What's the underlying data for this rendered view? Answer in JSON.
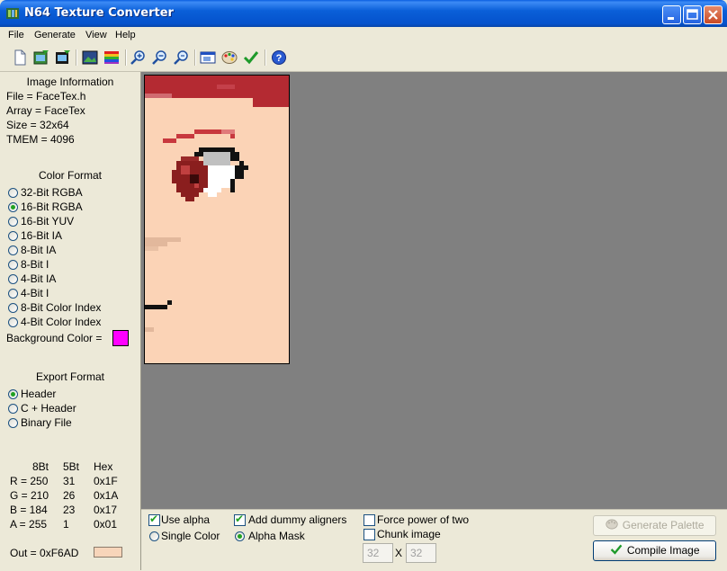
{
  "window": {
    "title": "N64 Texture Converter"
  },
  "menu": [
    "File",
    "Generate",
    "View",
    "Help"
  ],
  "toolbar": {
    "icons": [
      "new-icon",
      "open-image-icon",
      "save-image-icon",
      "image-icon",
      "palette-bars-icon",
      "zoom-in-icon",
      "zoom-reset-icon",
      "zoom-out-icon",
      "fit-window-icon",
      "palette-icon",
      "compile-check-icon",
      "help-icon"
    ]
  },
  "image_info": {
    "heading": "Image Information",
    "file": "File = FaceTex.h",
    "array": "Array = FaceTex",
    "size": "Size = 32x64",
    "tmem": "TMEM = 4096"
  },
  "color_format": {
    "heading": "Color Format",
    "options": [
      "32-Bit RGBA",
      "16-Bit RGBA",
      "16-Bit YUV",
      "16-Bit IA",
      "8-Bit IA",
      "8-Bit I",
      "4-Bit IA",
      "4-Bit I",
      "8-Bit Color Index",
      "4-Bit Color Index"
    ],
    "selected": "16-Bit RGBA",
    "background_label": "Background Color =",
    "background_color": "#FF00FF"
  },
  "export_format": {
    "heading": "Export Format",
    "options": [
      "Header",
      "C + Header",
      "Binary File"
    ],
    "selected": "Header"
  },
  "pixel_info": {
    "headers": [
      "8Bt",
      "5Bt",
      "Hex"
    ],
    "rows": [
      {
        "label": "R = 250",
        "b5": "31",
        "hex": "0x1F"
      },
      {
        "label": "G = 210",
        "b5": "26",
        "hex": "0x1A"
      },
      {
        "label": "B = 184",
        "b5": "23",
        "hex": "0x17"
      },
      {
        "label": "A = 255",
        "b5": "1",
        "hex": "0x01"
      }
    ],
    "out": "Out = 0xF6AD",
    "out_color": "#F7D5BA"
  },
  "options": {
    "use_alpha": {
      "label": "Use alpha",
      "checked": true
    },
    "single_color": {
      "label": "Single Color",
      "checked": false
    },
    "add_dummy_aligners": {
      "label": "Add dummy aligners",
      "checked": true
    },
    "alpha_mask": {
      "label": "Alpha Mask",
      "checked": true
    },
    "force_power_of_two": {
      "label": "Force power of two",
      "checked": false
    },
    "chunk_image": {
      "label": "Chunk image",
      "checked": false
    },
    "chunk_w": "32",
    "chunk_x": "X",
    "chunk_h": "32"
  },
  "buttons": {
    "generate_palette": "Generate Palette",
    "compile_image": "Compile Image"
  }
}
